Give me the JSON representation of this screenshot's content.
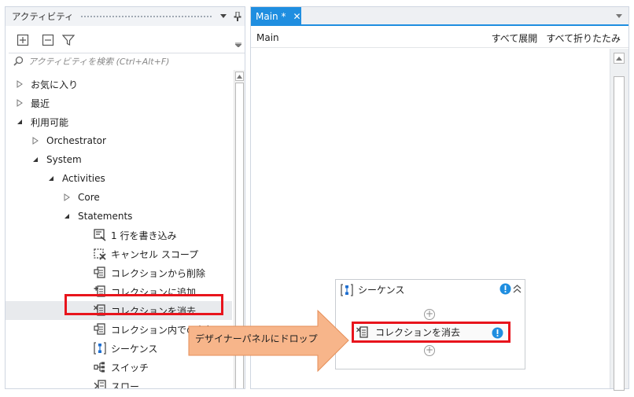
{
  "activities_panel": {
    "title": "アクティビティ",
    "pin_glyph": "▾ ⊥",
    "search": {
      "placeholder": "アクティビティを検索 (Ctrl+Alt+F)"
    },
    "toolbar_icons": [
      "expand-all-icon",
      "collapse-all-icon",
      "filter-icon"
    ],
    "tree": [
      {
        "label": "お気に入り",
        "state": "collapsed"
      },
      {
        "label": "最近",
        "state": "collapsed"
      },
      {
        "label": "利用可能",
        "state": "expanded"
      },
      {
        "label": "Orchestrator",
        "state": "collapsed"
      },
      {
        "label": "System",
        "state": "expanded"
      },
      {
        "label": "Activities",
        "state": "expanded"
      },
      {
        "label": "Core",
        "state": "collapsed"
      },
      {
        "label": "Statements",
        "state": "expanded"
      },
      {
        "label": "1 行を書き込み",
        "icon": "write-line-icon"
      },
      {
        "label": "キャンセル スコープ",
        "icon": "cancel-scope-icon"
      },
      {
        "label": "コレクションから削除",
        "icon": "collection-icon"
      },
      {
        "label": "コレクションに追加",
        "icon": "collection-icon"
      },
      {
        "label": "コレクションを消去",
        "icon": "collection-icon",
        "selected": true
      },
      {
        "label": "コレクション内での有無",
        "icon": "collection-icon"
      },
      {
        "label": "シーケンス",
        "icon": "sequence-icon"
      },
      {
        "label": "スイッチ",
        "icon": "switch-icon"
      },
      {
        "label": "スロー",
        "icon": "throw-icon"
      }
    ]
  },
  "designer": {
    "tab": {
      "label": "Main *",
      "close": "✕"
    },
    "breadcrumb": "Main",
    "expand_all": "すべて展開",
    "collapse_all": "すべて折りたたみ",
    "sequence": {
      "title": "シーケンス",
      "activity": "コレクションを消去"
    }
  },
  "annotation": {
    "arrow_text": "デザイナーパネルにドロップ",
    "highlight_color": "#e8141c",
    "arrow_color": "#f7b58a"
  },
  "colors": {
    "accent": "#1f8ee0",
    "alert": "#1f8ee0"
  }
}
